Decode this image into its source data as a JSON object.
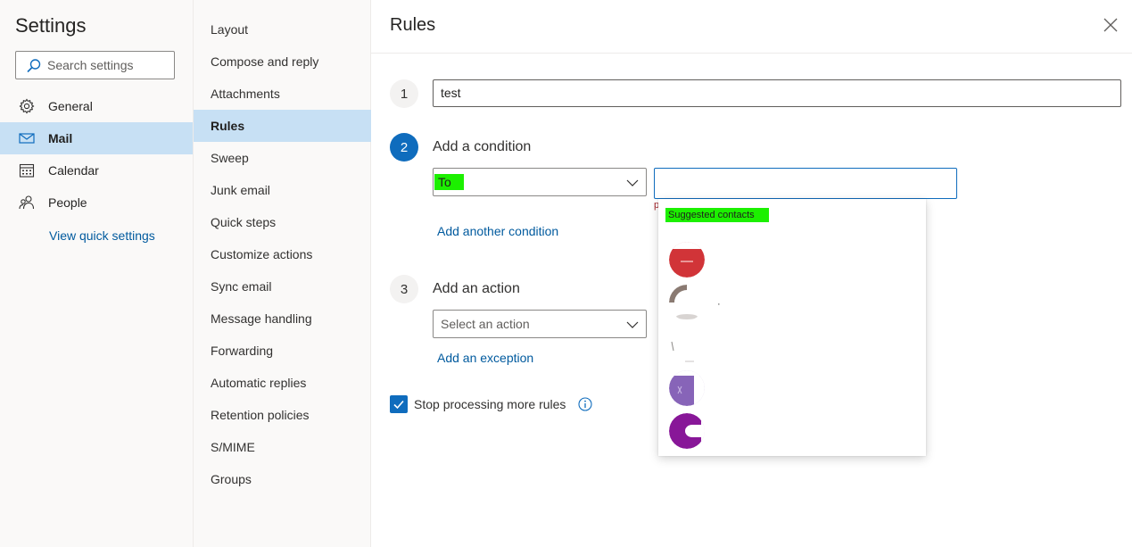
{
  "left": {
    "title": "Settings",
    "search_placeholder": "Search settings",
    "nav": [
      {
        "label": "General",
        "icon": "gear-icon"
      },
      {
        "label": "Mail",
        "icon": "mail-icon",
        "selected": true
      },
      {
        "label": "Calendar",
        "icon": "calendar-icon"
      },
      {
        "label": "People",
        "icon": "people-icon"
      }
    ],
    "quick_settings_link": "View quick settings"
  },
  "middle": {
    "items": [
      "Layout",
      "Compose and reply",
      "Attachments",
      "Rules",
      "Sweep",
      "Junk email",
      "Quick steps",
      "Customize actions",
      "Sync email",
      "Message handling",
      "Forwarding",
      "Automatic replies",
      "Retention policies",
      "S/MIME",
      "Groups"
    ],
    "selected": "Rules"
  },
  "rules": {
    "title": "Rules",
    "step1": {
      "number": "1",
      "name_value": "test"
    },
    "step2": {
      "number": "2",
      "label": "Add a condition",
      "condition_value": "To",
      "add_condition_link": "Add another condition",
      "error_fragment": "p"
    },
    "step3": {
      "number": "3",
      "label": "Add an action",
      "action_placeholder": "Select an action",
      "add_exception_link": "Add an exception"
    },
    "stop_processing": {
      "label": "Stop processing more rules",
      "checked": true
    }
  },
  "suggestions": {
    "header": "Suggested contacts"
  },
  "colors": {
    "accent": "#0f6cbd",
    "selected_bg": "#c7e0f4",
    "highlight": "#1cf000",
    "link": "#005a9e"
  }
}
